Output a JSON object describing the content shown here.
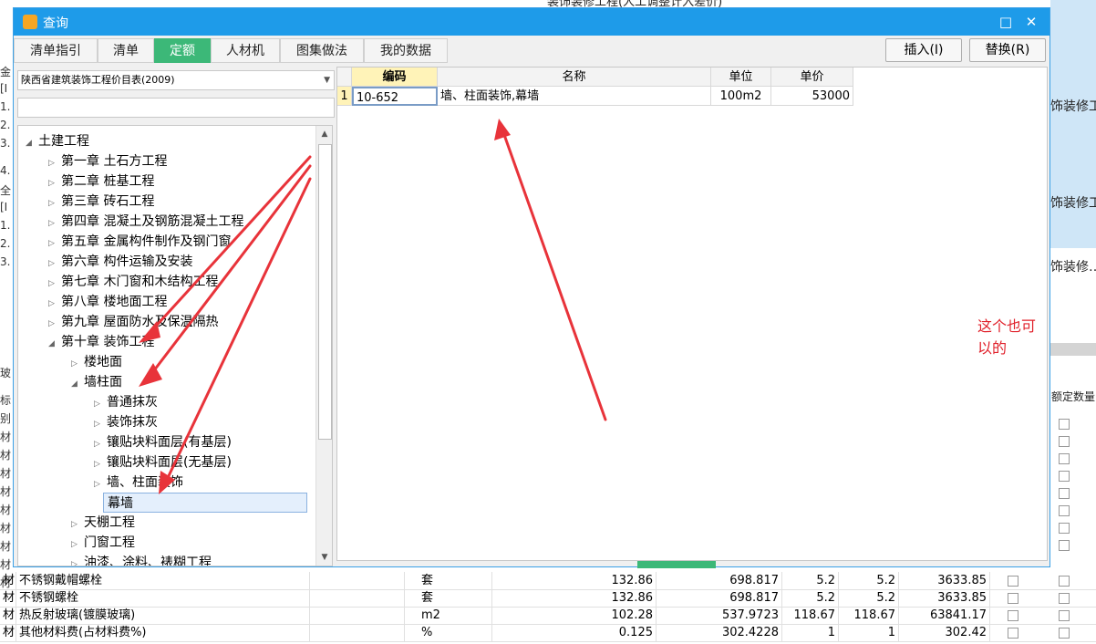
{
  "background_app": {
    "right_col_texts": [
      "饰装修工",
      "饰装修工",
      "饰装修…"
    ],
    "right_header": "额定数量",
    "left_strip_chars": [
      "金",
      "[I",
      "1.",
      "2.",
      "3.",
      "4.",
      "全",
      "[I",
      "1.",
      "2.",
      "3.",
      "玻",
      "标",
      "别",
      "材",
      "材",
      "材",
      "材",
      "材",
      "材",
      "材",
      "材",
      "材"
    ],
    "top_partial_row": "装饰装修工程(人工调整计入差价)"
  },
  "dialog": {
    "title": "查询",
    "title_icon": "query-app-icon",
    "maximize_label": "□",
    "close_label": "✕",
    "tabs": [
      {
        "label": "清单指引"
      },
      {
        "label": "清单"
      },
      {
        "label": "定额"
      },
      {
        "label": "人材机"
      },
      {
        "label": "图集做法"
      },
      {
        "label": "我的数据"
      }
    ],
    "insert_button": "插入(I)",
    "replace_button": "替换(R)",
    "library_select": "陕西省建筑装饰工程价目表(2009)",
    "search_value": "",
    "tree": [
      {
        "label": "土建工程"
      },
      {
        "label": "第一章 土石方工程"
      },
      {
        "label": "第二章 桩基工程"
      },
      {
        "label": "第三章 砖石工程"
      },
      {
        "label": "第四章 混凝土及钢筋混凝土工程"
      },
      {
        "label": "第五章 金属构件制作及钢门窗"
      },
      {
        "label": "第六章 构件运输及安装"
      },
      {
        "label": "第七章 木门窗和木结构工程"
      },
      {
        "label": "第八章 楼地面工程"
      },
      {
        "label": "第九章 屋面防水及保温隔热"
      },
      {
        "label": "第十章 装饰工程"
      },
      {
        "label": "楼地面"
      },
      {
        "label": "墙柱面"
      },
      {
        "label": "普通抹灰"
      },
      {
        "label": "装饰抹灰"
      },
      {
        "label": "镶贴块料面层(有基层)"
      },
      {
        "label": "镶贴块料面层(无基层)"
      },
      {
        "label": "墙、柱面装饰"
      },
      {
        "label": "幕墙"
      },
      {
        "label": "天棚工程"
      },
      {
        "label": "门窗工程"
      },
      {
        "label": "油漆、涂料、裱糊工程"
      }
    ],
    "grid": {
      "headers": [
        "编码",
        "名称",
        "单位",
        "单价"
      ],
      "rows": [
        {
          "index": "1",
          "code": "10-652",
          "name": "墙、柱面装饰,幕墙",
          "unit": "100m2",
          "price": "53000"
        }
      ]
    },
    "annotation": "这个也可以的"
  },
  "bottom_table": {
    "rows": [
      {
        "type": "材",
        "name": "不锈钢戴帽螺栓",
        "unit": "套",
        "v1": "132.86",
        "v2": "698.817",
        "v3": "5.2",
        "v4": "5.2",
        "v5": "3633.85"
      },
      {
        "type": "材",
        "name": "不锈钢螺栓",
        "unit": "套",
        "v1": "132.86",
        "v2": "698.817",
        "v3": "5.2",
        "v4": "5.2",
        "v5": "3633.85"
      },
      {
        "type": "材",
        "name": "热反射玻璃(镀膜玻璃)",
        "unit": "m2",
        "v1": "102.28",
        "v2": "537.9723",
        "v3": "118.67",
        "v4": "118.67",
        "v5": "63841.17"
      },
      {
        "type": "材",
        "name": "其他材料费(占材料费%)",
        "unit": "%",
        "v1": "0.125",
        "v2": "302.4228",
        "v3": "1",
        "v4": "1",
        "v5": "302.42"
      }
    ]
  },
  "colors": {
    "titlebar": "#1e9be9",
    "active_tab": "#3cb878",
    "annotation": "#e0202a",
    "arrow": "#e8333a"
  }
}
